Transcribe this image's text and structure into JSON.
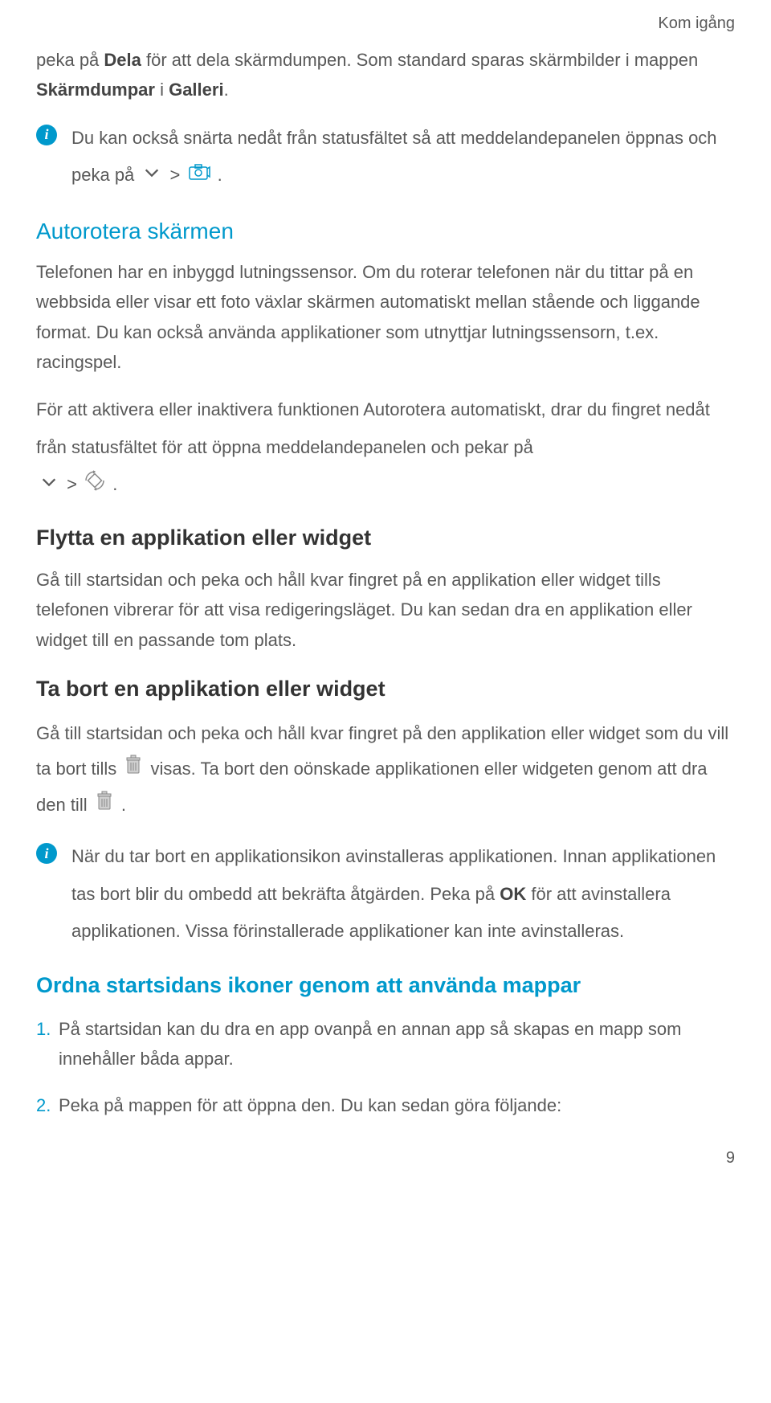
{
  "header": {
    "breadcrumb": "Kom igång"
  },
  "para_intro": {
    "pre": "peka på ",
    "bold1": "Dela",
    "mid1": " för att dela skärmdumpen. Som standard sparas skärmbilder i mappen ",
    "bold2": "Skärmdumpar",
    "mid2": " i ",
    "bold3": "Galleri",
    "post": "."
  },
  "info1": {
    "text_pre": "Du kan också snärta nedåt från statusfältet så att meddelandepanelen öppnas och peka på ",
    "gt": " > ",
    "text_post": "."
  },
  "autorotate": {
    "heading": "Autorotera skärmen",
    "p1": "Telefonen har en inbyggd lutningssensor. Om du roterar telefonen när du tittar på en webbsida eller visar ett foto växlar skärmen automatiskt mellan stående och liggande format. Du kan också använda applikationer som utnyttjar lutningssensorn, t.ex. racingspel.",
    "p2_pre": "För att aktivera eller inaktivera funktionen Autorotera automatiskt, drar du fingret nedåt från statusfältet för att öppna meddelandepanelen och pekar på ",
    "gt": " > ",
    "p2_post": "."
  },
  "flytta": {
    "heading": "Flytta en applikation eller widget",
    "p1": "Gå till startsidan och peka och håll kvar fingret på en applikation eller widget tills telefonen vibrerar för att visa redigeringsläget. Du kan sedan dra en applikation eller widget till en passande tom plats."
  },
  "tabort": {
    "heading": "Ta bort en applikation eller widget",
    "p1_pre": "Gå till startsidan och peka och håll kvar fingret på den applikation eller widget som du vill ta bort tills ",
    "p1_mid": " visas. Ta bort den oönskade applikationen eller widgeten genom att dra den till ",
    "p1_post": "."
  },
  "info2": {
    "text_pre": "När du tar bort en applikationsikon avinstalleras applikationen. Innan applikationen tas bort blir du ombedd att bekräfta åtgärden. Peka på ",
    "bold1": "OK",
    "text_post": " för att avinstallera applikationen. Vissa förinstallerade applikationer kan inte avinstalleras."
  },
  "ordna": {
    "heading": "Ordna startsidans ikoner genom att använda mappar",
    "item1_num": "1. ",
    "item1": "På startsidan kan du dra en app ovanpå en annan app så skapas en mapp som innehåller båda appar.",
    "item2_num": "2. ",
    "item2": "Peka på mappen för att öppna den. Du kan sedan göra följande:"
  },
  "page_number": "9"
}
